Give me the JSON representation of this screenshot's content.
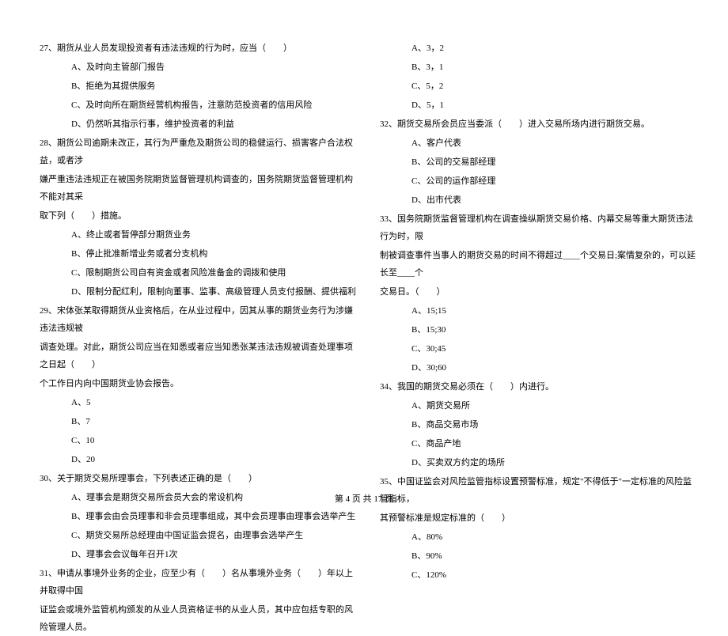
{
  "left_column": {
    "q27": {
      "text": "27、期货从业人员发现投资者有违法违规的行为时，应当（　　）",
      "options": [
        "A、及时向主管部门报告",
        "B、拒绝为其提供服务",
        "C、及时向所在期货经营机构报告，注意防范投资者的信用风险",
        "D、仍然听其指示行事，维护投资者的利益"
      ]
    },
    "q28": {
      "text_line1": "28、期货公司逾期未改正，其行为严重危及期货公司的稳健运行、损害客户合法权益，或者涉",
      "text_line2": "嫌严重违法违规正在被国务院期货监督管理机构调查的，国务院期货监督管理机构不能对其采",
      "text_line3": "取下列（　　）措施。",
      "options": [
        "A、终止或者暂停部分期货业务",
        "B、停止批准新增业务或者分支机构",
        "C、限制期货公司自有资金或者风险准备金的调拨和使用",
        "D、限制分配红利，限制向董事、监事、高级管理人员支付报酬、提供福利"
      ]
    },
    "q29": {
      "text_line1": "29、宋体张某取得期货从业资格后，在从业过程中，因其从事的期货业务行为涉嫌违法违规被",
      "text_line2": "调查处理。对此，期货公司应当在知悉或者应当知悉张某违法违规被调查处理事项之日起（　　）",
      "text_line3": "个工作日内向中国期货业协会报告。",
      "options": [
        "A、5",
        "B、7",
        "C、10",
        "D、20"
      ]
    },
    "q30": {
      "text": "30、关于期货交易所理事会，下列表述正确的是（　　）",
      "options": [
        "A、理事会是期货交易所会员大会的常设机构",
        "B、理事会由会员理事和非会员理事组成，其中会员理事由理事会选举产生",
        "C、期货交易所总经理由中国证监会提名，由理事会选举产生",
        "D、理事会会议每年召开1次"
      ]
    },
    "q31": {
      "text_line1": "31、申请从事境外业务的企业，应至少有（　　）名从事境外业务（　　）年以上并取得中国",
      "text_line2": "证监会或境外监管机构颁发的从业人员资格证书的从业人员，其中应包括专职的风险管理人员。"
    }
  },
  "right_column": {
    "q31_options": [
      "A、3，2",
      "B、3，1",
      "C、5，2",
      "D、5，1"
    ],
    "q32": {
      "text": "32、期货交易所会员应当委派（　　）进入交易所场内进行期货交易。",
      "options": [
        "A、客户代表",
        "B、公司的交易部经理",
        "C、公司的运作部经理",
        "D、出市代表"
      ]
    },
    "q33": {
      "text_line1": "33、国务院期货监督管理机构在调查操纵期货交易价格、内幕交易等重大期货违法行为时，限",
      "text_line2": "制被调查事件当事人的期货交易的时间不得超过____个交易日;案情复杂的，可以延长至____个",
      "text_line3": "交易日。（　　）",
      "options": [
        "A、15;15",
        "B、15;30",
        "C、30;45",
        "D、30;60"
      ]
    },
    "q34": {
      "text": "34、我国的期货交易必须在（　　）内进行。",
      "options": [
        "A、期货交易所",
        "B、商品交易市场",
        "C、商品产地",
        "D、买卖双方约定的场所"
      ]
    },
    "q35": {
      "text_line1": "35、中国证监会对风险监管指标设置预警标准，规定\"不得低于\"一定标准的风险监管指标，",
      "text_line2": "其预警标准是规定标准的（　　）",
      "options": [
        "A、80%",
        "B、90%",
        "C、120%"
      ]
    }
  },
  "footer": "第 4 页 共 17 页"
}
